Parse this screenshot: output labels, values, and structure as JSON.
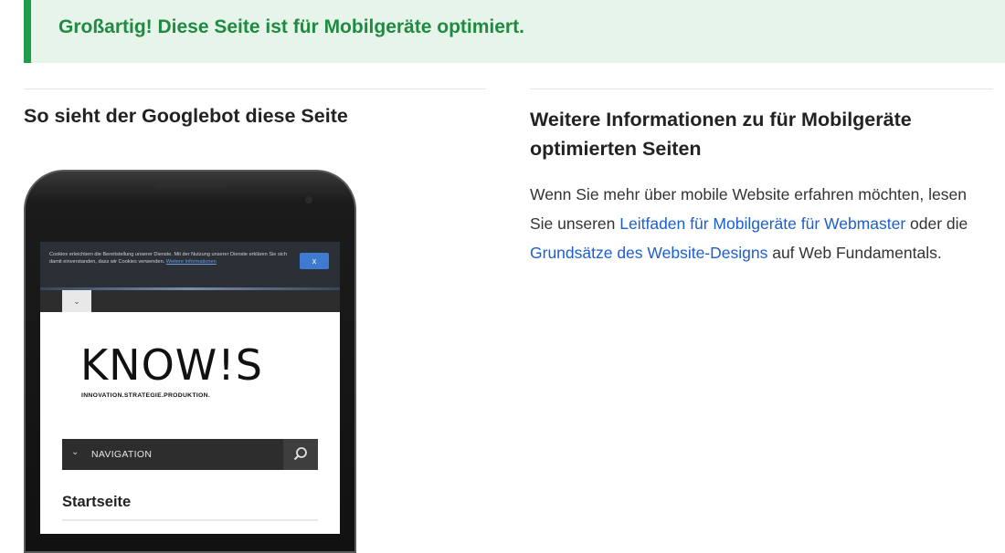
{
  "banner": {
    "message": "Großartig! Diese Seite ist für Mobilgeräte optimiert."
  },
  "left": {
    "heading": "So sieht der Googlebot diese Seite"
  },
  "right": {
    "heading": "Weitere Informationen zu für Mobilgeräte optimierten Seiten",
    "text_before_link1": "Wenn Sie mehr über mobile Website erfahren möchten, lesen Sie unseren ",
    "link1": "Leitfaden für Mobilgeräte für Webmaster",
    "text_between": " oder die ",
    "link2": "Grundsätze des Website-Designs",
    "text_after": " auf Web Fundamentals."
  },
  "phone_screen": {
    "cookie_text": "Cookies erleichtern die Bereitstellung unserer Dienste. Mit der Nutzung unserer Dienste erklären Sie sich damit einverstanden, dass wir Cookies verwenden. ",
    "cookie_more": "Weitere Informationen",
    "cookie_close": "x",
    "toggle_glyph": "⌄",
    "logo": "KNOW!S",
    "tagline": "INNOVATION.STRATEGIE.PRODUKTION.",
    "nav_chevron": "⌄",
    "nav_label": "NAVIGATION",
    "menu_item": "Startseite"
  },
  "icons": {
    "banner_accent": "#1e9e4a",
    "link_color": "#1a5fd1",
    "search": "search-icon"
  }
}
